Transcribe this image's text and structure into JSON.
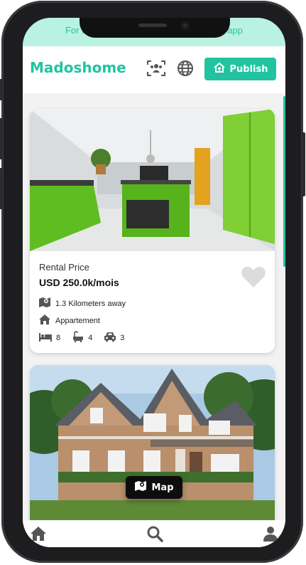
{
  "banner": {
    "text": "For the best experience use the mobile app"
  },
  "header": {
    "logo": "Madoshome",
    "publish_label": "Publish"
  },
  "listings": [
    {
      "price_label": "Rental Price",
      "price": "USD 250.0k/mois",
      "distance": "1.3 Kilometers away",
      "type": "Appartement",
      "beds": "8",
      "baths": "4",
      "cars": "3",
      "favorite": false
    }
  ],
  "map_button": {
    "label": "Map"
  },
  "colors": {
    "accent": "#22c3a1",
    "banner_bg": "#b9f2e1"
  },
  "icons": [
    "team-icon",
    "globe-icon",
    "house-upload-icon",
    "heart-icon",
    "map-icon",
    "home-icon",
    "bed-icon",
    "bath-icon",
    "car-icon",
    "search-icon",
    "user-icon"
  ]
}
